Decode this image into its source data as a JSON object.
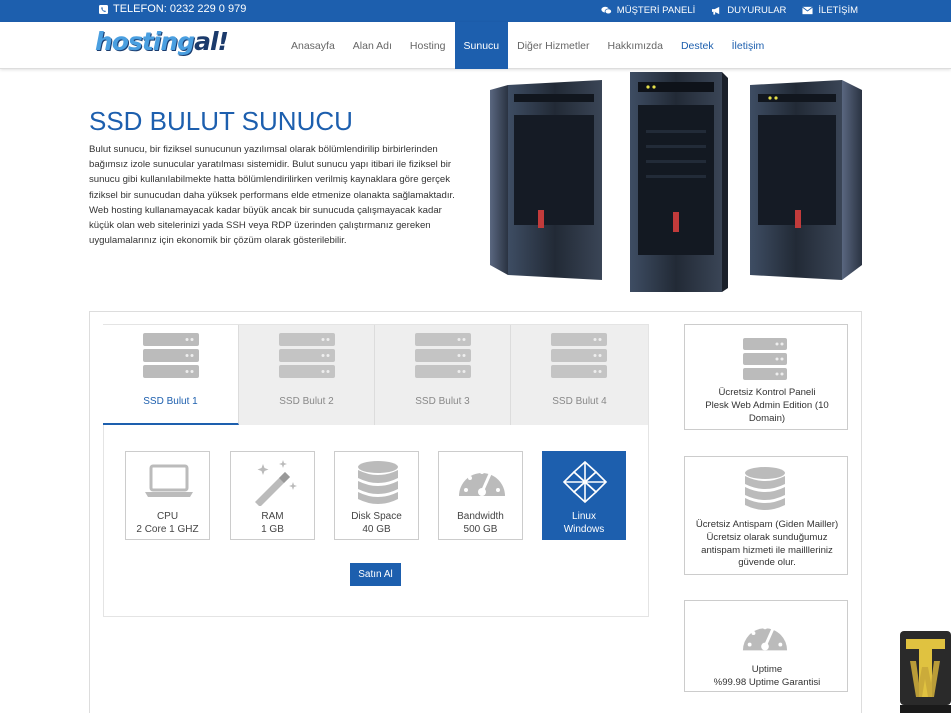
{
  "topbar": {
    "phone": "TELEFON: 0232 229 0 979",
    "links": [
      "MÜŞTERİ PANELİ",
      "DUYURULAR",
      "İLETİŞİM"
    ]
  },
  "logo": {
    "part1": "hosting",
    "part2": "al!"
  },
  "nav": [
    "Anasayfa",
    "Alan Adı",
    "Hosting",
    "Sunucu",
    "Diğer Hizmetler",
    "Hakkımızda",
    "Destek",
    "İletişim"
  ],
  "hero": {
    "title": "SSD BULUT SUNUCU",
    "text": "Bulut sunucu, bir fiziksel sunucunun yazılımsal olarak bölümlendirilip birbirlerinden bağımsız izole sunucular yaratılması sistemidir. Bulut sunucu yapı itibari ile fiziksel bir sunucu gibi kullanılabilmekte hatta bölümlendirilirken verilmiş kaynaklara göre gerçek fiziksel bir sunucudan daha yüksek performans elde etmenize olanakta sağlamaktadır. Web hosting kullanamayacak kadar büyük ancak bir sunucuda çalışmayacak kadar küçük olan web sitelerinizi yada SSH veya RDP üzerinden çalıştırmanız gereken uygulamalarınız için ekonomik bir çözüm olarak gösterilebilir."
  },
  "tabs": [
    "SSD Bulut 1",
    "SSD Bulut 2",
    "SSD Bulut 3",
    "SSD Bulut 4"
  ],
  "specs": [
    {
      "name": "CPU",
      "value": "2 Core 1 GHZ",
      "icon": "laptop-icon"
    },
    {
      "name": "RAM",
      "value": "1 GB",
      "icon": "magic-wand-icon"
    },
    {
      "name": "Disk Space",
      "value": "40 GB",
      "icon": "database-icon"
    },
    {
      "name": "Bandwidth",
      "value": "500 GB",
      "icon": "gauge-icon"
    },
    {
      "name": "Linux",
      "value": "Windows",
      "icon": "os-icon"
    }
  ],
  "buy_label": "Satın Al",
  "features": [
    {
      "lines": [
        "Ücretsiz Kontrol Paneli",
        "Plesk Web Admin Edition (10",
        "Domain)"
      ],
      "icon": "server-icon"
    },
    {
      "lines": [
        "Ücretsiz Antispam (Giden Mailler)",
        "Ücretsiz olarak sunduğumuz",
        "antispam hizmeti ile maillleriniz",
        "güvende olur."
      ],
      "icon": "database-icon"
    },
    {
      "lines": [
        "Uptime",
        "%99.98 Uptime Garantisi"
      ],
      "icon": "gauge-icon"
    }
  ],
  "colors": {
    "brand": "#1d5fae",
    "topbar": "#1d5fae"
  }
}
